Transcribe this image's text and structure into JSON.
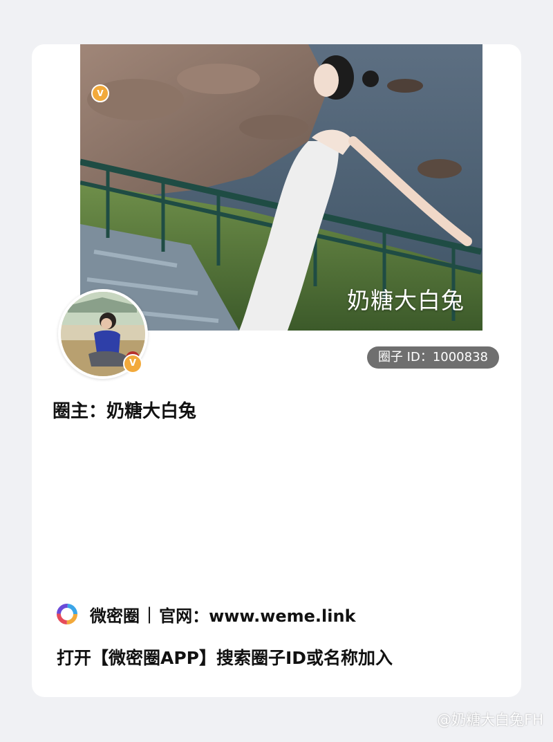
{
  "cover": {
    "caption": "奶糖大白兔",
    "badge_icon": "verified-v-icon",
    "badge_text": "V"
  },
  "avatar": {
    "badge_icon": "verified-v-icon",
    "badge_text": "V"
  },
  "circle": {
    "id_text": "圈子 ID：1000838",
    "owner_text": "圈主：奶糖大白兔"
  },
  "footer": {
    "brand": "微密圈",
    "separator": "|",
    "site_text": "官网：www.weme.link",
    "instruction": "打开【微密圈APP】搜索圈子ID或名称加入",
    "logo_icon": "weme-ring-logo-icon"
  },
  "watermark": {
    "text": "@奶糖大白兔FH"
  },
  "colors": {
    "badge": "#f2a93b",
    "pill": "#6f6f6f",
    "background": "#f0f1f4"
  }
}
